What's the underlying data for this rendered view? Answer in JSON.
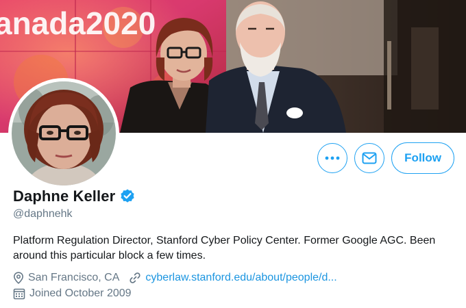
{
  "banner": {
    "sign_text": "anada2020"
  },
  "profile": {
    "name": "Daphne Keller",
    "handle": "@daphnehk",
    "bio": "Platform Regulation Director, Stanford Cyber Policy Center. Former Google AGC. Been around this particular block a few times.",
    "location": "San Francisco, CA",
    "website": "cyberlaw.stanford.edu/about/people/d...",
    "joined": "Joined October 2009"
  },
  "actions": {
    "more_icon": "more-dots-icon",
    "message_icon": "envelope-icon",
    "follow_label": "Follow"
  },
  "icons": {
    "verified": "verified-badge-icon",
    "location": "location-pin-icon",
    "link": "link-icon",
    "calendar": "calendar-icon"
  },
  "colors": {
    "accent": "#1da1f2",
    "link": "#1b95e0",
    "text_primary": "#14171a",
    "text_secondary": "#657786"
  }
}
